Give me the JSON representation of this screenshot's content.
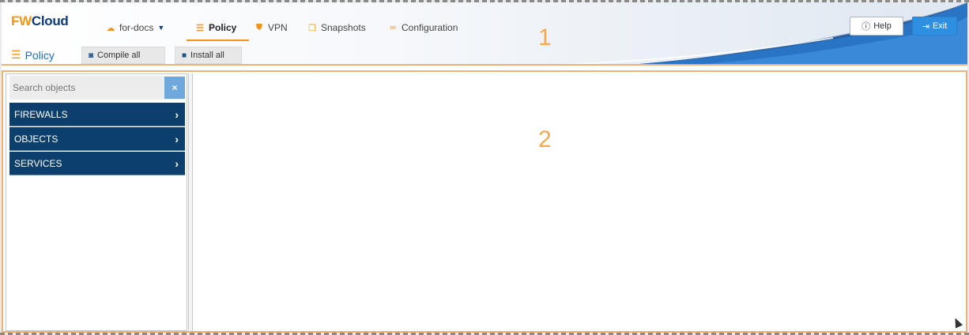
{
  "app": {
    "logo_fw": "FW",
    "logo_cloud": "Cloud"
  },
  "nav": {
    "context": {
      "label": "for-docs",
      "icon": "cloud-icon"
    },
    "items": [
      {
        "label": "Policy",
        "icon": "list-icon",
        "active": true
      },
      {
        "label": "VPN",
        "icon": "shield-icon"
      },
      {
        "label": "Snapshots",
        "icon": "copy-icon"
      },
      {
        "label": "Configuration",
        "icon": "link-icon"
      }
    ]
  },
  "header_buttons": {
    "help": "Help",
    "exit": "Exit"
  },
  "toolbar": {
    "title": "Policy",
    "compile_all": "Compile all",
    "install_all": "Install all"
  },
  "markers": {
    "one": "1",
    "two": "2"
  },
  "sidebar": {
    "search_placeholder": "Search objects",
    "clear_label": "×",
    "categories": [
      "FIREWALLS",
      "OBJECTS",
      "SERVICES"
    ]
  },
  "colors": {
    "accent_orange": "#f7941d",
    "navy": "#0d3f6c",
    "exit_blue": "#2e8ee0"
  }
}
